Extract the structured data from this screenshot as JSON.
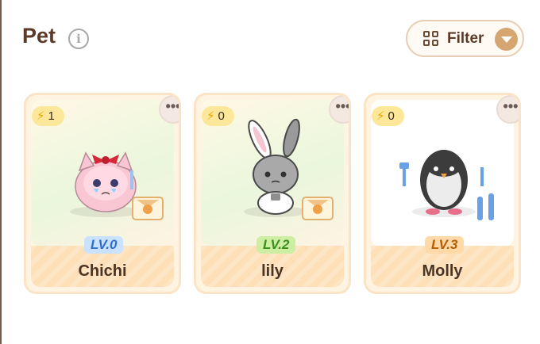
{
  "header": {
    "title": "Pet",
    "info_icon": "info-icon",
    "filter_label": "Filter",
    "filter_icon": "grid-icon",
    "filter_caret": "chevron-down-icon"
  },
  "pets": [
    {
      "name": "Chichi",
      "level": "LV.0",
      "energy": "1",
      "more": "•••",
      "bg": "gradient",
      "extra_icon": "envelope-icon"
    },
    {
      "name": "lily",
      "level": "LV.2",
      "energy": "0",
      "more": "•••",
      "bg": "gradient",
      "extra_icon": "envelope-icon"
    },
    {
      "name": "Molly",
      "level": "LV.3",
      "energy": "0",
      "more": "•••",
      "bg": "plain",
      "extra_icon": "cutlery-icon"
    }
  ],
  "colors": {
    "accent": "#d6a671",
    "title": "#5b3a29",
    "card_base": "#fde0b8",
    "energy_badge": "#fde79a"
  }
}
